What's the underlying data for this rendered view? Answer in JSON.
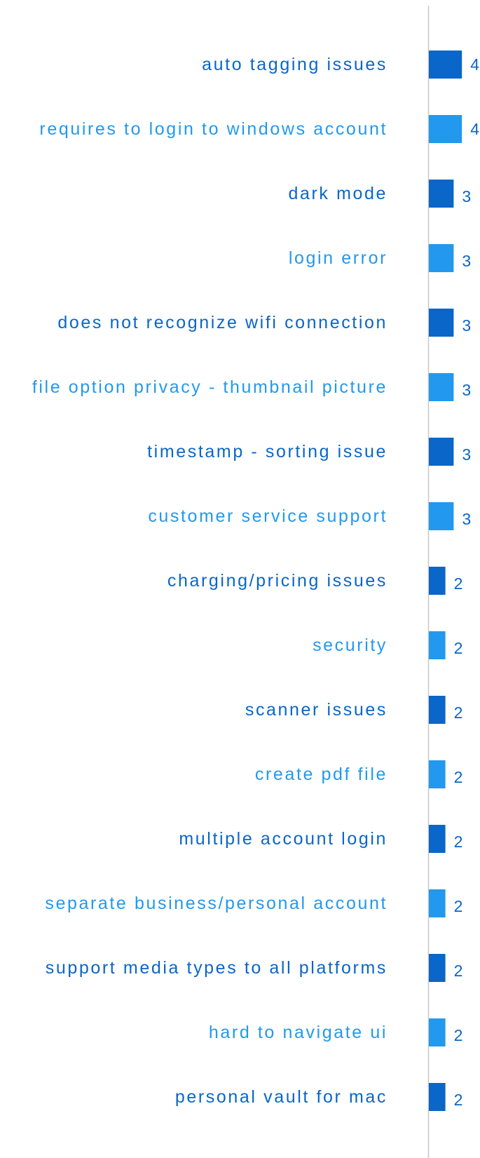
{
  "chart_data": {
    "type": "bar",
    "orientation": "horizontal",
    "title": "",
    "xlabel": "",
    "ylabel": "",
    "xlim": [
      0,
      4
    ],
    "grid": false,
    "legend": "none",
    "colors": [
      "#0a66c8",
      "#2299ee"
    ],
    "categories": [
      "auto tagging issues",
      "requires to login to windows account",
      "dark mode",
      "login error",
      "does not recognize wifi connection",
      "file option privacy - thumbnail picture",
      "timestamp - sorting issue",
      "customer service support",
      "charging/pricing issues",
      "security",
      "scanner issues",
      "create pdf file",
      "multiple account login",
      "separate business/personal account",
      "support media types to all platforms",
      "hard to navigate ui",
      "personal vault for mac"
    ],
    "values": [
      4,
      4,
      3,
      3,
      3,
      3,
      3,
      3,
      2,
      2,
      2,
      2,
      2,
      2,
      2,
      2,
      2
    ]
  }
}
